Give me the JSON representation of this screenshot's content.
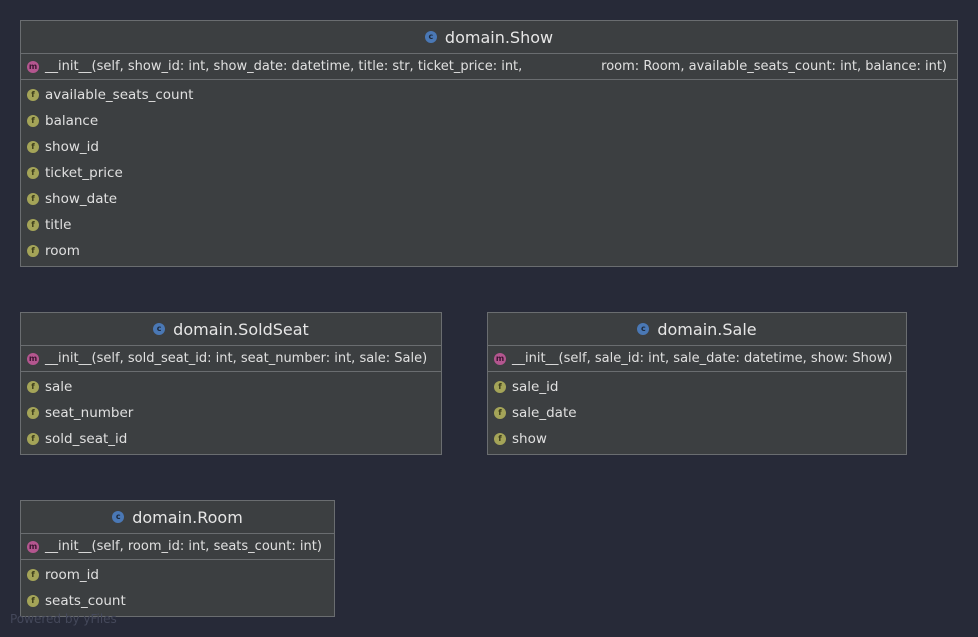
{
  "classes": {
    "show": {
      "name": "domain.Show",
      "class_icon": "c",
      "method_icon": "m",
      "field_icon": "f",
      "init_left": "__init__(self, show_id: int, show_date: datetime, title: str, ticket_price: int,",
      "init_right": "room: Room, available_seats_count: int, balance: int)",
      "fields": [
        "available_seats_count",
        "balance",
        "show_id",
        "ticket_price",
        "show_date",
        "title",
        "room"
      ]
    },
    "soldseat": {
      "name": "domain.SoldSeat",
      "class_icon": "c",
      "method_icon": "m",
      "field_icon": "f",
      "init": "__init__(self, sold_seat_id: int, seat_number: int, sale: Sale)",
      "fields": [
        "sale",
        "seat_number",
        "sold_seat_id"
      ]
    },
    "sale": {
      "name": "domain.Sale",
      "class_icon": "c",
      "method_icon": "m",
      "field_icon": "f",
      "init": "__init__(self, sale_id: int, sale_date: datetime, show: Show)",
      "fields": [
        "sale_id",
        "sale_date",
        "show"
      ]
    },
    "room": {
      "name": "domain.Room",
      "class_icon": "c",
      "method_icon": "m",
      "field_icon": "f",
      "init": "__init__(self, room_id: int, seats_count: int)",
      "fields": [
        "room_id",
        "seats_count"
      ]
    }
  },
  "watermark": "Powered by yFiles",
  "colors": {
    "background": "#272a38",
    "node_fill": "#3c3f41",
    "node_border": "#6a6d70",
    "class_icon": "#4a78b5",
    "method_icon": "#b4568f",
    "field_icon": "#a4a458"
  }
}
